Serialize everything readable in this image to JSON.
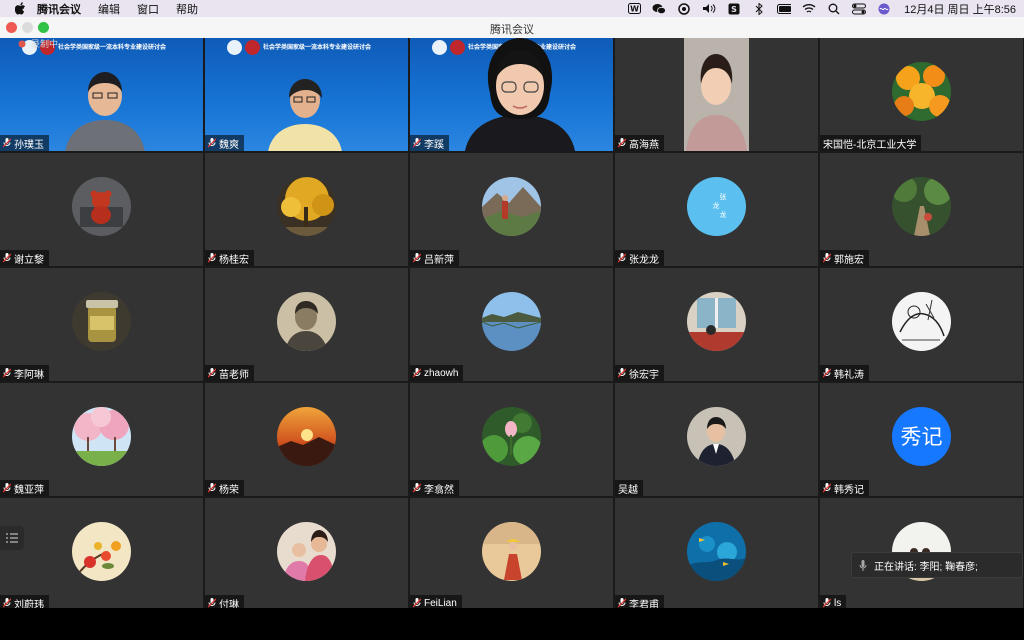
{
  "menubar": {
    "app_name": "腾讯会议",
    "menus": [
      "编辑",
      "窗口",
      "帮助"
    ],
    "clock": "12月4日 周日 上午8:56"
  },
  "window": {
    "title": "腾讯会议",
    "recording_label": "录制中"
  },
  "banner_text": "社会学类国家级一流本科专业建设研讨会",
  "participants": [
    {
      "name": "孙璞玉",
      "kind": "video"
    },
    {
      "name": "魏爽",
      "kind": "video"
    },
    {
      "name": "李蹊",
      "kind": "video"
    },
    {
      "name": "高海燕",
      "kind": "video"
    },
    {
      "name": "宋国恺-北京工业大学",
      "kind": "avatar",
      "avatar": "marigold-flowers"
    },
    {
      "name": "谢立黎",
      "kind": "avatar",
      "avatar": "red-toy-bear"
    },
    {
      "name": "杨桂宏",
      "kind": "avatar",
      "avatar": "autumn-ginkgo-tree"
    },
    {
      "name": "吕新萍",
      "kind": "avatar",
      "avatar": "person-in-mountains"
    },
    {
      "name": "张龙龙",
      "kind": "avatar",
      "avatar": "text-avatar",
      "avatar_text": "张龙龙"
    },
    {
      "name": "郭施宏",
      "kind": "avatar",
      "avatar": "garden-path"
    },
    {
      "name": "李阿琳",
      "kind": "avatar",
      "avatar": "jar"
    },
    {
      "name": "苗老师",
      "kind": "avatar",
      "avatar": "old-photo-portrait"
    },
    {
      "name": "zhaowh",
      "kind": "avatar",
      "avatar": "lake-reflection"
    },
    {
      "name": "徐宏宇",
      "kind": "avatar",
      "avatar": "room-window"
    },
    {
      "name": "韩礼涛",
      "kind": "avatar",
      "avatar": "sketch-drawing"
    },
    {
      "name": "魏亚萍",
      "kind": "avatar",
      "avatar": "cherry-blossom-tree"
    },
    {
      "name": "杨荣",
      "kind": "avatar",
      "avatar": "sunset-mountains"
    },
    {
      "name": "李翕然",
      "kind": "avatar",
      "avatar": "lotus-flower"
    },
    {
      "name": "吴越",
      "kind": "avatar",
      "avatar": "man-in-suit",
      "no_mic_icon": true
    },
    {
      "name": "韩秀记",
      "kind": "avatar",
      "avatar": "text-avatar-blue",
      "avatar_text": "秀记"
    },
    {
      "name": "刘蔚玮",
      "kind": "avatar",
      "avatar": "bird-flower-painting"
    },
    {
      "name": "付琳",
      "kind": "avatar",
      "avatar": "mother-child"
    },
    {
      "name": "FeiLian",
      "kind": "avatar",
      "avatar": "girl-on-beach"
    },
    {
      "name": "李君甫",
      "kind": "avatar",
      "avatar": "aquarium"
    },
    {
      "name": "ls",
      "kind": "avatar",
      "avatar": "beach-people"
    }
  ],
  "speaking": {
    "text": "正在讲话: 李阳; 鞠春彦;"
  },
  "colors": {
    "tile_bg": "#333333",
    "grid_gap": "#1a1a1a",
    "blue_avatar": "#1677ff",
    "light_blue_avatar": "#5bc0f0"
  }
}
